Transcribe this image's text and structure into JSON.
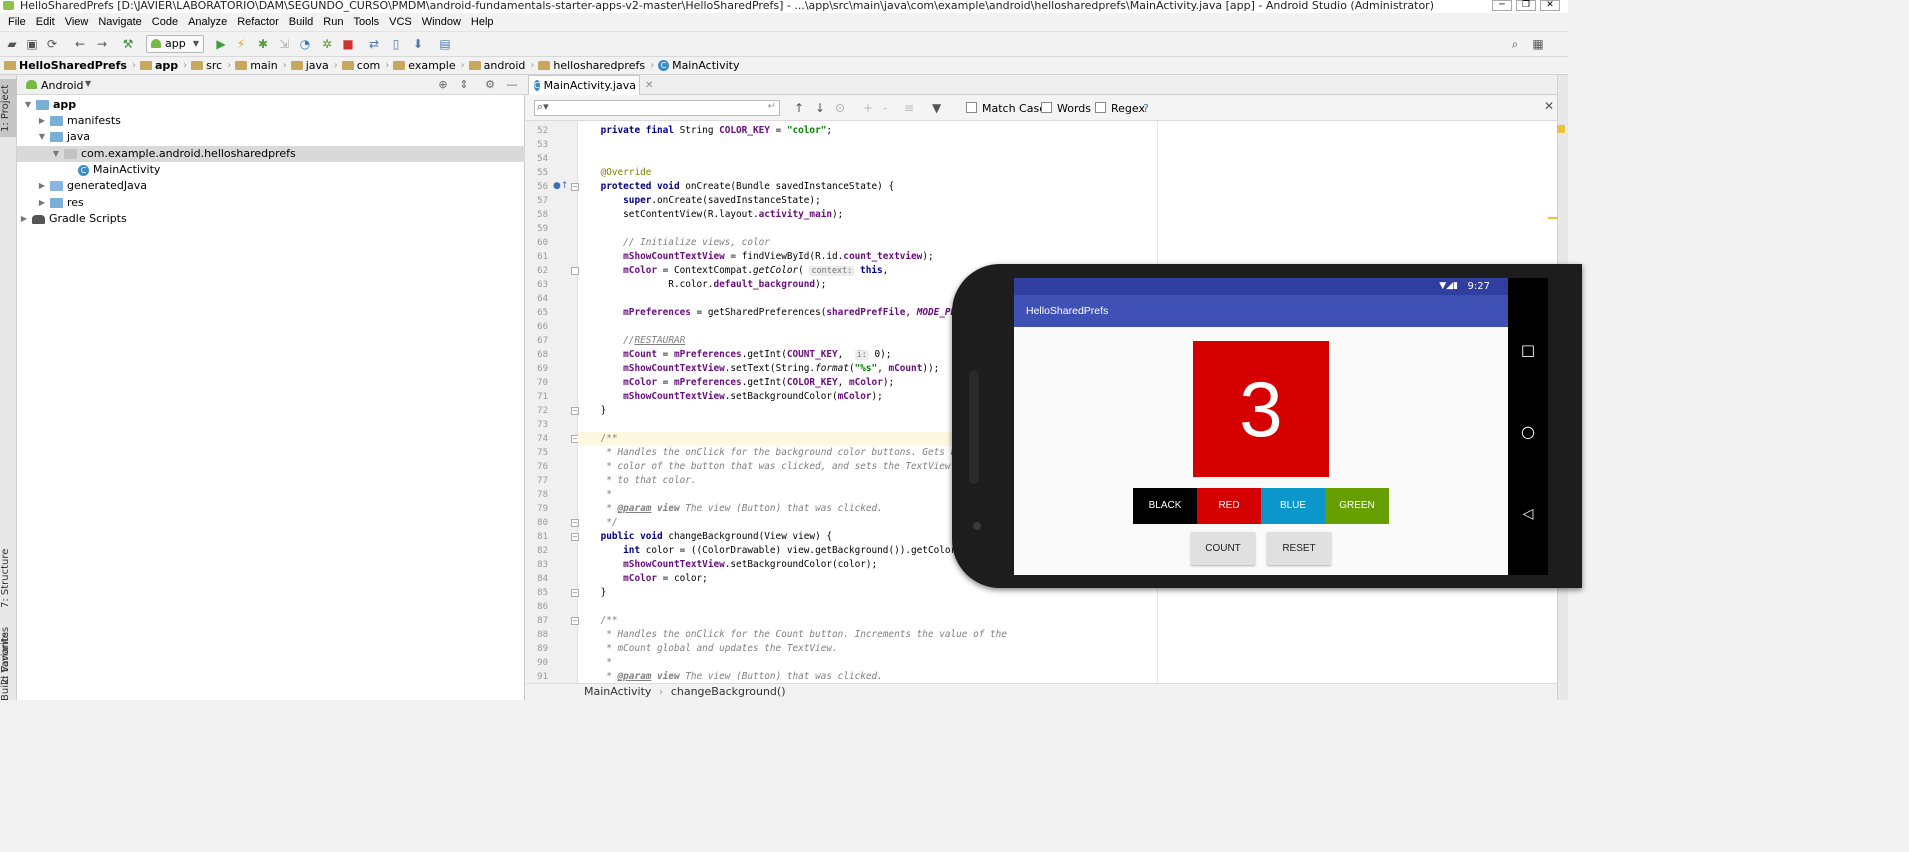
{
  "window": {
    "title": "HelloSharedPrefs [D:\\JAVIER\\LABORATORIO\\DAM\\SEGUNDO_CURSO\\PMDM\\android-fundamentals-starter-apps-v2-master\\HelloSharedPrefs] - ...\\app\\src\\main\\java\\com\\example\\android\\hellosharedprefs\\MainActivity.java [app] - Android Studio (Administrator)"
  },
  "menu": [
    "File",
    "Edit",
    "View",
    "Navigate",
    "Code",
    "Analyze",
    "Refactor",
    "Build",
    "Run",
    "Tools",
    "VCS",
    "Window",
    "Help"
  ],
  "toolbar": {
    "run_config": "app"
  },
  "breadcrumb": [
    "HelloSharedPrefs",
    "app",
    "src",
    "main",
    "java",
    "com",
    "example",
    "android",
    "hellosharedprefs",
    "MainActivity"
  ],
  "left_tabs": {
    "project": "1: Project",
    "structure": "7: Structure",
    "favorites": "2: Favorites",
    "build_variants": "Build Variants"
  },
  "project": {
    "view_mode": "Android",
    "tree": [
      "app",
      "manifests",
      "java",
      "com.example.android.hellosharedprefs",
      "MainActivity",
      "generatedJava",
      "res",
      "Gradle Scripts"
    ]
  },
  "editor": {
    "tab": "MainActivity.java",
    "find": {
      "match_case": "Match Case",
      "words": "Words",
      "regex": "Regex",
      "help": "?"
    },
    "status_class": "MainActivity",
    "status_method": "changeBackground()",
    "lines": [
      {
        "n": "52",
        "html": "    <span class='kw'>private final</span> String <span class='fld'>COLOR_KEY</span> = <span class='str'>\"color\"</span>;"
      },
      {
        "n": "53",
        "html": ""
      },
      {
        "n": "54",
        "html": ""
      },
      {
        "n": "55",
        "html": "    <span class='ann'>@Override</span>"
      },
      {
        "n": "56",
        "html": "    <span class='kw'>protected void</span> onCreate(Bundle savedInstanceState) {"
      },
      {
        "n": "57",
        "html": "        <span class='kw'>super</span>.onCreate(savedInstanceState);"
      },
      {
        "n": "58",
        "html": "        setContentView(R.layout.<span class='fld'>activity_main</span>);"
      },
      {
        "n": "59",
        "html": ""
      },
      {
        "n": "60",
        "html": "        <span class='cmt'>// Initialize views, color</span>"
      },
      {
        "n": "61",
        "html": "        <span class='fld'>mShowCountTextView</span> = findViewById(R.id.<span class='fld'>count_textview</span>);"
      },
      {
        "n": "62",
        "html": "        <span class='fld'>mColor</span> = ContextCompat.<i>getColor</i>( <span class='hint'>context:</span> <span class='kw'>this</span>,"
      },
      {
        "n": "63",
        "html": "                R.color.<span class='fld'>default_background</span>);"
      },
      {
        "n": "64",
        "html": ""
      },
      {
        "n": "65",
        "html": "        <span class='fld'>mPreferences</span> = getSharedPreferences(<span class='fld'>sharedPrefFile</span>, <span class='fld'><i>MODE_PRIVATE</i></span>);"
      },
      {
        "n": "66",
        "html": ""
      },
      {
        "n": "67",
        "html": "        <span class='cmt'>//<u>RESTAURAR</u></span>"
      },
      {
        "n": "68",
        "html": "        <span class='fld'>mCount</span> = <span class='fld'>mPreferences</span>.getInt(<span class='fld'>COUNT_KEY</span>,  <span class='hint'>i:</span> 0);"
      },
      {
        "n": "69",
        "html": "        <span class='fld'>mShowCountTextView</span>.setText(String.<i>format</i>(<span class='str'>\"%s\"</span>, <span class='fld'>mCount</span>));"
      },
      {
        "n": "70",
        "html": "        <span class='fld'>mColor</span> = <span class='fld'>mPreferences</span>.getInt(<span class='fld'>COLOR_KEY</span>, <span class='fld'>mColor</span>);"
      },
      {
        "n": "71",
        "html": "        <span class='fld'>mShowCountTextView</span>.setBackgroundColor(<span class='fld'>mColor</span>);"
      },
      {
        "n": "72",
        "html": "    }"
      },
      {
        "n": "73",
        "html": ""
      },
      {
        "n": "74",
        "html": "    <span class='cmt'>/**</span>"
      },
      {
        "n": "75",
        "html": "<span class='cmt'>     * Handles the onClick for the background color buttons. Gets background</span>"
      },
      {
        "n": "76",
        "html": "<span class='cmt'>     * color of the button that was clicked, and sets the TextView background</span>"
      },
      {
        "n": "77",
        "html": "<span class='cmt'>     * to that color.</span>"
      },
      {
        "n": "78",
        "html": "<span class='cmt'>     *</span>"
      },
      {
        "n": "79",
        "html": "<span class='cmt'>     * <b><u>@param</u></b> <b>view</b> The view (Button) that was clicked.</span>"
      },
      {
        "n": "80",
        "html": "<span class='cmt'>     */</span>"
      },
      {
        "n": "81",
        "html": "    <span class='kw'>public void</span> changeBackground(View view) {"
      },
      {
        "n": "82",
        "html": "        <span class='kw'>int</span> color = ((ColorDrawable) view.getBackground()).getColor();"
      },
      {
        "n": "83",
        "html": "        <span class='fld'>mShowCountTextView</span>.setBackgroundColor(color);"
      },
      {
        "n": "84",
        "html": "        <span class='fld'>mColor</span> = color;"
      },
      {
        "n": "85",
        "html": "    }"
      },
      {
        "n": "86",
        "html": ""
      },
      {
        "n": "87",
        "html": "    <span class='cmt'>/**</span>"
      },
      {
        "n": "88",
        "html": "<span class='cmt'>     * Handles the onClick for the Count button. Increments the value of the</span>"
      },
      {
        "n": "89",
        "html": "<span class='cmt'>     * mCount global and updates the TextView.</span>"
      },
      {
        "n": "90",
        "html": "<span class='cmt'>     *</span>"
      },
      {
        "n": "91",
        "html": "<span class='cmt'>     * <b><u>@param</u></b> <b>view</b> The view (Button) that was clicked.</span>"
      }
    ]
  },
  "emulator": {
    "time": "9:27",
    "app_title": "HelloSharedPrefs",
    "count": "3",
    "count_bg": "#d50000",
    "color_buttons": [
      {
        "label": "BLACK",
        "color": "#000000"
      },
      {
        "label": "RED",
        "color": "#d50000"
      },
      {
        "label": "BLUE",
        "color": "#0b97c9"
      },
      {
        "label": "GREEN",
        "color": "#689f00"
      }
    ],
    "count_button": "COUNT",
    "reset_button": "RESET"
  },
  "colors": {
    "statusbar": "#303f9f",
    "appbar": "#3f51b5"
  }
}
